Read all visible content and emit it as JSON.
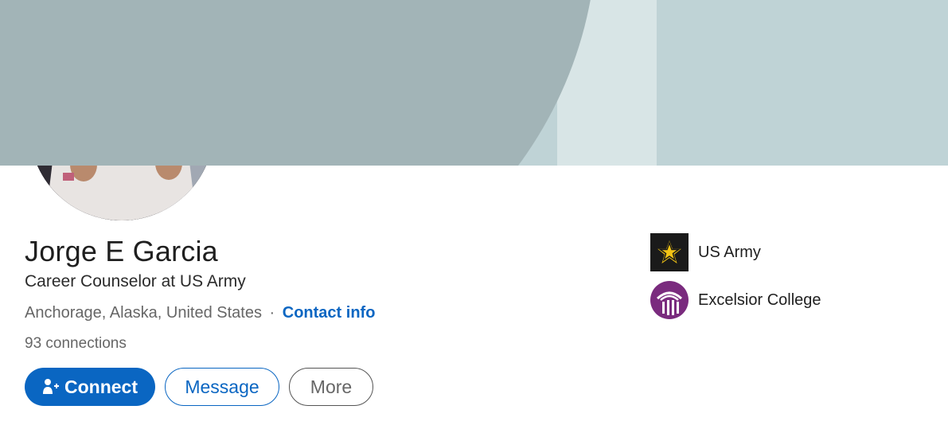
{
  "profile": {
    "name": "Jorge E Garcia",
    "headline": "Career Counselor at US Army",
    "location": "Anchorage, Alaska, United States",
    "separator": "·",
    "contact_info_label": "Contact info",
    "connections_count": "93",
    "connections_label": "connections"
  },
  "actions": {
    "connect_label": "Connect",
    "message_label": "Message",
    "more_label": "More"
  },
  "organizations": [
    {
      "name": "US Army",
      "logo": "army-star-icon"
    },
    {
      "name": "Excelsior College",
      "logo": "excelsior-college-logo"
    }
  ],
  "colors": {
    "primary": "#0a66c2",
    "banner_dark": "#a2b4b7",
    "banner_light": "#bfd3d6",
    "army_gold": "#f2c314"
  }
}
